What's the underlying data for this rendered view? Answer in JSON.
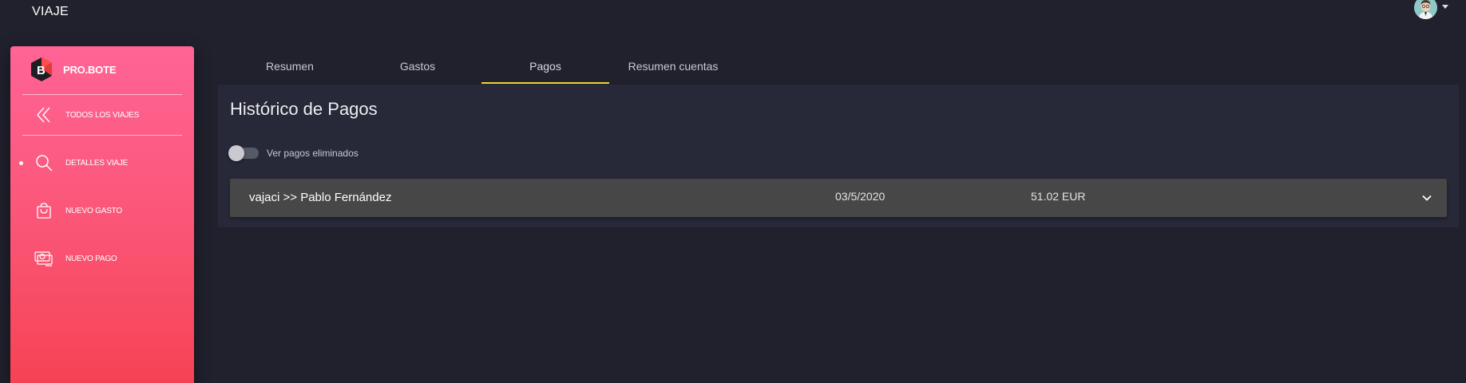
{
  "header": {
    "title": "VIAJE",
    "avatar_icon": "avatar-icon"
  },
  "sidebar": {
    "brand": "PRO.BOTE",
    "items": [
      {
        "label": "TODOS LOS VIAJES",
        "icon": "double-chevron-left-icon"
      },
      {
        "label": "DETALLES VIAJE",
        "icon": "search-icon",
        "active": true
      },
      {
        "label": "NUEVO GASTO",
        "icon": "shopping-bag-icon"
      },
      {
        "label": "NUEVO PAGO",
        "icon": "money-icon"
      }
    ]
  },
  "tabs": [
    {
      "label": "Resumen"
    },
    {
      "label": "Gastos"
    },
    {
      "label": "Pagos",
      "active": true
    },
    {
      "label": "Resumen cuentas"
    }
  ],
  "panel": {
    "title": "Histórico de Pagos",
    "toggle_label": "Ver pagos eliminados",
    "toggle_on": false,
    "payments": [
      {
        "parties": "vajaci >> Pablo Fernández",
        "date": "03/5/2020",
        "amount": "51.02 EUR"
      }
    ]
  },
  "colors": {
    "accent": "#f3d233",
    "sidebar_top": "#ff6496",
    "sidebar_bottom": "#f64252",
    "background": "#20212d"
  }
}
